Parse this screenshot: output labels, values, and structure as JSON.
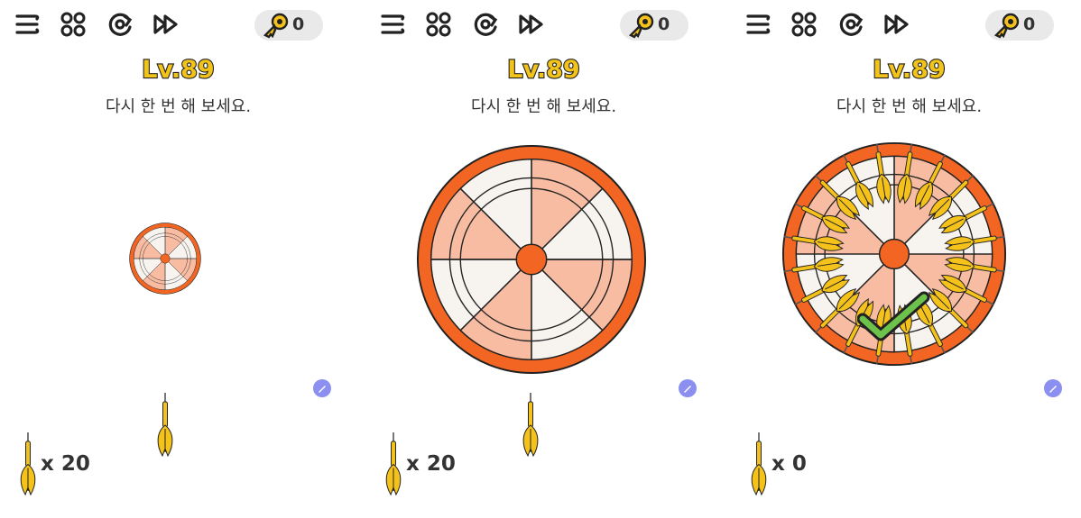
{
  "level": "Lv.89",
  "hint": "다시 한 번 해 보세요.",
  "keys": "0",
  "icons": [
    "menu-icon",
    "levels-grid-icon",
    "restart-icon",
    "skip-icon",
    "key-icon",
    "dart-icon",
    "edit-badge-icon",
    "checkmark-icon"
  ],
  "panels": [
    {
      "darts_remaining": "x 20",
      "board_size": "small",
      "darts_on_board": 0
    },
    {
      "darts_remaining": "x 20",
      "board_size": "large",
      "darts_on_board": 0
    },
    {
      "darts_remaining": "x 0",
      "board_size": "large",
      "darts_on_board": 20,
      "solved": true
    }
  ],
  "colors": {
    "board_orange": "#f26522",
    "segment_light": "#f8bca2",
    "segment_white": "#f7f3ef",
    "dart_yellow": "#f4c21b",
    "level_gold": "#f2c318",
    "check_green": "#6cc24a"
  }
}
